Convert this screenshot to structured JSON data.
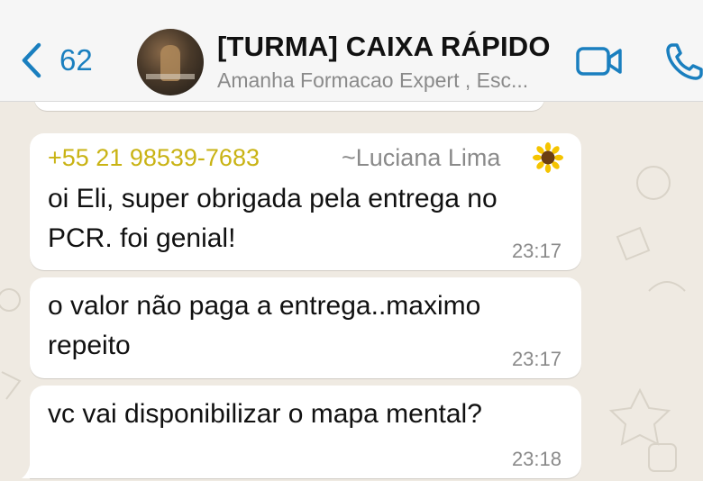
{
  "header": {
    "back_count": "62",
    "title": "[TURMA] CAIXA RÁPIDO",
    "subtitle": "Amanha Formacao Expert , Esc..."
  },
  "messages": [
    {
      "sender": "+55 21 98539-7683",
      "pushname": "~Luciana Lima",
      "text": "oi Eli, super obrigada pela entrega no PCR. foi genial!",
      "time": "23:17"
    },
    {
      "text": "o valor não paga a entrega..maximo repeito",
      "time": "23:17"
    },
    {
      "text": "vc vai disponibilizar o mapa mental?",
      "time": "23:18"
    }
  ],
  "colors": {
    "accent": "#1a7fbf",
    "sender_name": "#c9b314",
    "chat_background": "#efeae2",
    "bubble": "#ffffff"
  },
  "icons": [
    "chevron-left-icon",
    "video-call-icon",
    "phone-icon",
    "sunflower-emoji"
  ]
}
